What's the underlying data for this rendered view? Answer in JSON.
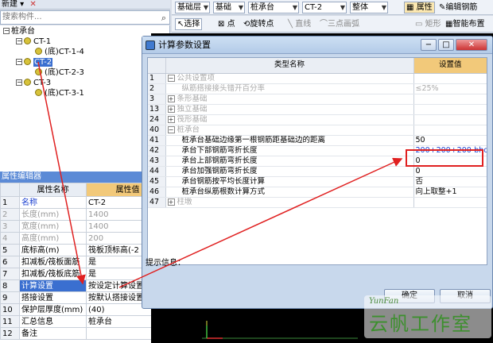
{
  "left_toolbar": {
    "new_label": "新建 ▾",
    "delete_icon": "✕"
  },
  "search": {
    "placeholder": "搜索构件..."
  },
  "tree": [
    {
      "label": "桩承台",
      "level": 0
    },
    {
      "label": "CT-1",
      "level": 1
    },
    {
      "label": "(底)CT-1-4",
      "level": 2
    },
    {
      "label": "CT-2",
      "level": 1,
      "selected": true
    },
    {
      "label": "(底)CT-2-3",
      "level": 2
    },
    {
      "label": "CT-3",
      "level": 1
    },
    {
      "label": "(底)CT-3-1",
      "level": 2
    }
  ],
  "prop_panel": {
    "title": "属性编辑器",
    "col_name": "属性名称",
    "col_value": "属性值",
    "rows": [
      {
        "n": "1",
        "name": "名称",
        "value": "CT-2",
        "style": "blue"
      },
      {
        "n": "2",
        "name": "长度(mm)",
        "value": "1400",
        "style": "grey"
      },
      {
        "n": "3",
        "name": "宽度(mm)",
        "value": "1400",
        "style": "grey"
      },
      {
        "n": "4",
        "name": "高度(mm)",
        "value": "200",
        "style": "grey"
      },
      {
        "n": "5",
        "name": "底标高(m)",
        "value": "筏板顶标高(-2",
        "style": ""
      },
      {
        "n": "6",
        "name": "扣减板/筏板面筋",
        "value": "是",
        "style": ""
      },
      {
        "n": "7",
        "name": "扣减板/筏板底筋",
        "value": "是",
        "style": ""
      },
      {
        "n": "8",
        "name": "计算设置",
        "value": "按设定计算设置",
        "style": "sel"
      },
      {
        "n": "9",
        "name": "搭接设置",
        "value": "按默认搭接设置",
        "style": ""
      },
      {
        "n": "10",
        "name": "保护层厚度(mm)",
        "value": "(40)",
        "style": ""
      },
      {
        "n": "11",
        "name": "汇总信息",
        "value": "桩承台",
        "style": ""
      },
      {
        "n": "12",
        "name": "备注",
        "value": "",
        "style": ""
      }
    ]
  },
  "main_toolbar": {
    "floor": "基础层",
    "category": "基础",
    "type": "桩承台",
    "component": "CT-2",
    "scope": "整体",
    "attr_btn": "属性",
    "edit_rebar": "编辑钢筋",
    "select": "选择",
    "point": "点",
    "rotate_point": "旋转点",
    "line": "直线",
    "three_point_arc": "三点画弧",
    "rect": "矩形",
    "smart_layout": "智能布置"
  },
  "dialog": {
    "title": "计算参数设置",
    "col_name": "类型名称",
    "col_value": "设置值",
    "rows": [
      {
        "n": "1",
        "name": "公共设置项",
        "value": "",
        "kind": "group",
        "exp": "−"
      },
      {
        "n": "2",
        "name": "纵筋搭接接头错开百分率",
        "value": "≤25%",
        "kind": "grey"
      },
      {
        "n": "3",
        "name": "条形基础",
        "value": "",
        "kind": "group",
        "exp": "+"
      },
      {
        "n": "13",
        "name": "独立基础",
        "value": "",
        "kind": "group",
        "exp": "+"
      },
      {
        "n": "24",
        "name": "筏形基础",
        "value": "",
        "kind": "group",
        "exp": "+"
      },
      {
        "n": "40",
        "name": "桩承台",
        "value": "",
        "kind": "group",
        "exp": "−"
      },
      {
        "n": "41",
        "name": "桩承台基础边缘第一根钢筋距基础边的距离",
        "value": "50",
        "kind": "item"
      },
      {
        "n": "42",
        "name": "承台下部钢筋弯折长度",
        "value": "200+200+200-bhc",
        "kind": "item"
      },
      {
        "n": "43",
        "name": "承台上部钢筋弯折长度",
        "value": "0",
        "kind": "item"
      },
      {
        "n": "44",
        "name": "承台加强钢筋弯折长度",
        "value": "0",
        "kind": "item"
      },
      {
        "n": "45",
        "name": "承台钢筋按平均长度计算",
        "value": "否",
        "kind": "item"
      },
      {
        "n": "46",
        "name": "桩承台纵筋根数计算方式",
        "value": "向上取整+1",
        "kind": "item"
      },
      {
        "n": "47",
        "name": "柱墩",
        "value": "",
        "kind": "group",
        "exp": "+"
      }
    ],
    "hint_label": "提示信息：",
    "ok": "确定",
    "cancel": "取消",
    "min": "−",
    "max": "□",
    "close": "✕"
  },
  "watermark": {
    "top": "YunFan",
    "main": "云帆工作室"
  },
  "colors": {
    "annotation": "#e02020",
    "selection": "#3a6fd0",
    "header_value": "#f2c97a"
  }
}
